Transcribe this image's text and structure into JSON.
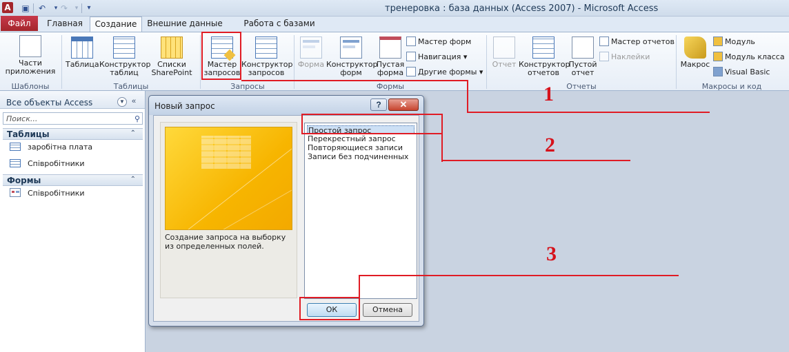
{
  "titlebar": {
    "title": "тренеровка : база данных (Access 2007)  -  Microsoft Access",
    "app_icon": "A",
    "qat_icons": [
      "save-icon",
      "undo-icon",
      "redo-icon",
      "customize-icon"
    ]
  },
  "tabs": [
    {
      "label": "Файл",
      "kind": "file"
    },
    {
      "label": "Главная"
    },
    {
      "label": "Создание",
      "active": true
    },
    {
      "label": "Внешние данные"
    },
    {
      "label": "Работа с базами данных"
    }
  ],
  "ribbon": {
    "templates": {
      "parts_line1": "Части",
      "parts_line2": "приложения",
      "group_label": "Шаблоны"
    },
    "tables": {
      "table": "Таблица",
      "designer_line1": "Конструктор",
      "designer_line2": "таблиц",
      "lists_line1": "Списки",
      "lists_line2": "SharePoint",
      "group_label": "Таблицы"
    },
    "queries": {
      "wizard_line1": "Мастер",
      "wizard_line2": "запросов",
      "designer_line1": "Конструктор",
      "designer_line2": "запросов",
      "group_label": "Запросы"
    },
    "forms": {
      "form": "Форма",
      "designer_line1": "Конструктор",
      "designer_line2": "форм",
      "blank_line1": "Пустая",
      "blank_line2": "форма",
      "wizard": "Мастер форм",
      "navigation": "Навигация",
      "other": "Другие формы",
      "group_label": "Формы"
    },
    "reports": {
      "report": "Отчет",
      "designer_line1": "Конструктор",
      "designer_line2": "отчетов",
      "blank_line1": "Пустой",
      "blank_line2": "отчет",
      "wizard": "Мастер отчетов",
      "labels": "Наклейки",
      "group_label": "Отчеты"
    },
    "macros": {
      "macro": "Макрос",
      "module": "Модуль",
      "class_module": "Модуль класса",
      "vba": "Visual Basic",
      "group_label": "Макросы и код"
    }
  },
  "nav": {
    "title": "Все объекты Access",
    "search_placeholder": "Поиск...",
    "sections": [
      {
        "label": "Таблицы",
        "items": [
          "заробітна плата",
          "Співробітники"
        ]
      },
      {
        "label": "Формы",
        "items": [
          "Співробітники"
        ]
      }
    ]
  },
  "dialog": {
    "title": "Новый запрос",
    "help": "?",
    "close": "✕",
    "description": "Создание запроса на выборку из определенных полей.",
    "options": [
      {
        "label": "Простой запрос",
        "selected": true
      },
      {
        "label": "Перекрестный запрос"
      },
      {
        "label": "Повторяющиеся записи"
      },
      {
        "label": "Записи без подчиненных"
      }
    ],
    "ok": "ОК",
    "cancel": "Отмена"
  },
  "annotations": [
    "1",
    "2",
    "3"
  ],
  "colors": {
    "annotation": "#e01b24",
    "file_tab": "#a4262c",
    "accent": "#4a78b8"
  }
}
